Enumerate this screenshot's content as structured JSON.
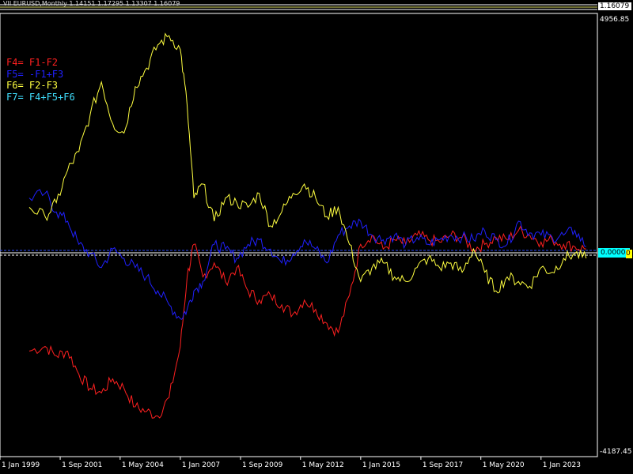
{
  "top_info": "VII EURUSD,Monthly 1.14151 1.17295 1.13307 1.16079",
  "price_label": "1.16079",
  "zero_label": "0.0000",
  "zero_label2": "0",
  "legend": [
    {
      "text": "F4= F1-F2",
      "color": "#ff2020"
    },
    {
      "text": "F5= -F1+F3",
      "color": "#2020ff"
    },
    {
      "text": "F6= F2-F3",
      "color": "#ffff40"
    },
    {
      "text": "F7= F4+F5+F6",
      "color": "#40e0ff"
    }
  ],
  "chart_data": {
    "type": "line",
    "ylim": [
      -4187.45,
      4956.85
    ],
    "y_tick_labels": [
      "4956.85",
      "-4187.45"
    ],
    "x_tick_labels": [
      "1 Jan 1999",
      "1 Sep 2001",
      "1 May 2004",
      "1 Jan 2007",
      "1 Sep 2009",
      "1 May 2012",
      "1 Jan 2015",
      "1 Sep 2017",
      "1 May 2020",
      "1 Jan 2023"
    ],
    "x_range": [
      1999.0,
      2025.5
    ],
    "x": [
      2000.3,
      2001.0,
      2001.5,
      2002.0,
      2002.5,
      2003.0,
      2003.5,
      2004.0,
      2004.5,
      2005.0,
      2005.5,
      2006.0,
      2006.5,
      2007.0,
      2007.3,
      2007.6,
      2008.0,
      2008.5,
      2009.0,
      2009.5,
      2010.0,
      2010.5,
      2011.0,
      2011.5,
      2012.0,
      2012.5,
      2013.0,
      2013.5,
      2014.0,
      2014.5,
      2015.0,
      2015.5,
      2016.0,
      2016.5,
      2017.0,
      2017.5,
      2018.0,
      2018.5,
      2019.0,
      2019.5,
      2020.0,
      2020.5,
      2021.0,
      2021.5,
      2022.0,
      2022.5,
      2023.0,
      2023.5,
      2024.0,
      2024.5,
      2025.0
    ],
    "series": [
      {
        "name": "F4= F1-F2",
        "color": "#ff2020",
        "values": [
          -2100,
          -2000,
          -2200,
          -2100,
          -2600,
          -2900,
          -3000,
          -2700,
          -2900,
          -3300,
          -3400,
          -3500,
          -3100,
          -2000,
          -500,
          200,
          -500,
          -200,
          -600,
          -300,
          -800,
          -1000,
          -900,
          -1100,
          -1300,
          -1000,
          -1200,
          -1500,
          -1700,
          -900,
          200,
          400,
          100,
          300,
          200,
          400,
          300,
          250,
          400,
          350,
          100,
          200,
          350,
          300,
          500,
          400,
          250,
          300,
          200,
          150,
          100
        ]
      },
      {
        "name": "F5= -F1+F3",
        "color": "#2020ff",
        "values": [
          1200,
          1300,
          900,
          700,
          200,
          0,
          -300,
          100,
          -100,
          -300,
          -500,
          -800,
          -1100,
          -1400,
          -1200,
          -800,
          -600,
          200,
          100,
          -100,
          200,
          300,
          100,
          -200,
          0,
          300,
          100,
          -200,
          400,
          600,
          700,
          400,
          300,
          400,
          200,
          350,
          200,
          300,
          400,
          350,
          300,
          500,
          300,
          200,
          700,
          450,
          400,
          350,
          400,
          500,
          150
        ]
      },
      {
        "name": "F6= F2-F3",
        "color": "#ffff40",
        "values": [
          1000,
          800,
          1100,
          1800,
          2200,
          3000,
          3700,
          2800,
          2600,
          3600,
          4000,
          4500,
          4700,
          4400,
          3200,
          1200,
          1500,
          700,
          1200,
          1100,
          1000,
          1300,
          600,
          900,
          1300,
          1500,
          1200,
          800,
          1000,
          200,
          -600,
          -300,
          -200,
          -500,
          -600,
          -300,
          -100,
          -300,
          -200,
          -400,
          100,
          -400,
          -800,
          -500,
          -600,
          -700,
          -300,
          -400,
          -100,
          0,
          -100
        ]
      },
      {
        "name": "F7= F4+F5+F6",
        "color": "#40e0ff",
        "values": [
          0,
          0,
          0,
          0,
          0,
          0,
          0,
          0,
          0,
          0,
          0,
          0,
          0,
          0,
          0,
          0,
          0,
          0,
          0,
          0,
          0,
          0,
          0,
          0,
          0,
          0,
          0,
          0,
          0,
          0,
          0,
          0,
          0,
          0,
          0,
          0,
          0,
          0,
          0,
          0,
          0,
          0,
          0,
          0,
          0,
          0,
          0,
          0,
          0,
          0,
          0
        ]
      }
    ]
  }
}
